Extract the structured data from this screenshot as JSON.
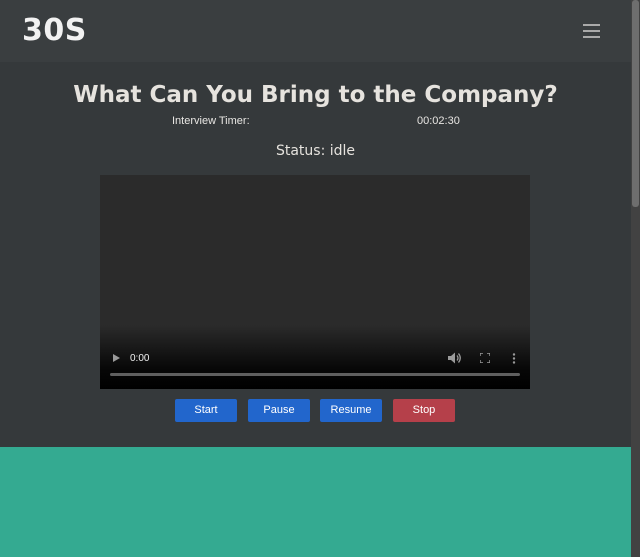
{
  "navbar": {
    "brand": "30S",
    "menu_icon": "hamburger-icon"
  },
  "page": {
    "title": "What Can You Bring to the Company?",
    "timer_label": "Interview Timer:",
    "timer_value": "00:02:30",
    "status": "Status: idle"
  },
  "video": {
    "current_time": "0:00",
    "icons": [
      "play-icon",
      "volume-icon",
      "fullscreen-icon",
      "more-options-icon"
    ]
  },
  "controls": {
    "start": "Start",
    "pause": "Pause",
    "resume": "Resume",
    "stop": "Stop"
  },
  "colors": {
    "primary": "#2266cc",
    "danger": "#b5404a",
    "footer": "#34aa91",
    "background": "#35393b"
  }
}
